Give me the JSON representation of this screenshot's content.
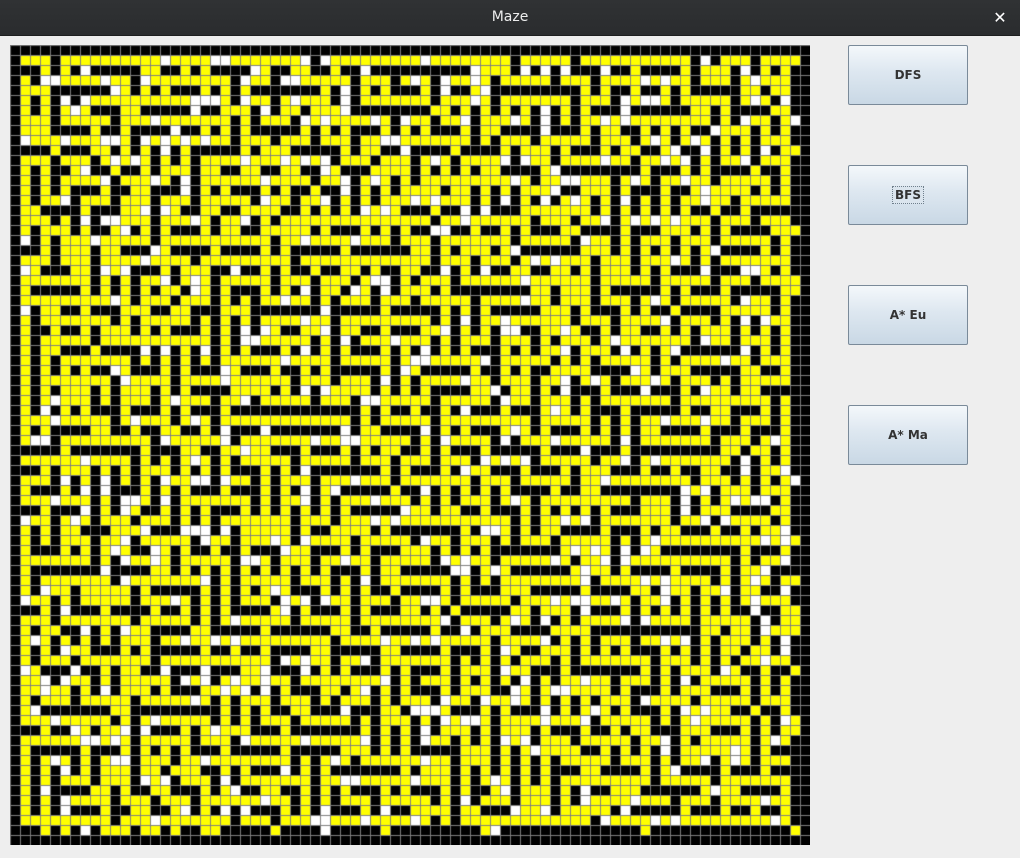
{
  "window": {
    "title": "Maze",
    "close_glyph": "✕"
  },
  "maze": {
    "rows": 80,
    "cols": 80,
    "colors": {
      "wall": "#000000",
      "visited": "#ffff00",
      "open": "#ffffff",
      "grid": "#7f7f7f"
    }
  },
  "buttons": [
    {
      "label": "DFS",
      "focused": false
    },
    {
      "label": "BFS",
      "focused": true
    },
    {
      "label": "A* Eu",
      "focused": false
    },
    {
      "label": "A* Ma",
      "focused": false
    }
  ]
}
